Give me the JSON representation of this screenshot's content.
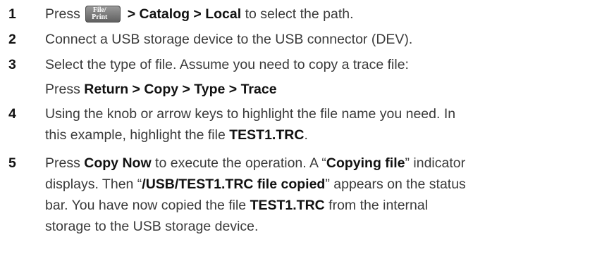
{
  "steps": [
    {
      "num": "1",
      "press": "Press",
      "key_line1": "File/",
      "key_line2": "Print",
      "path": "> Catalog > Local",
      "rest": "to select the path."
    },
    {
      "num": "2",
      "text": "Connect a USB storage device to the USB connector (DEV)."
    },
    {
      "num": "3",
      "text": "Select the type of file. Assume you need to copy a trace file:",
      "press": "Press",
      "path": "Return > Copy > Type > Trace"
    },
    {
      "num": "4",
      "line1": "Using the knob or arrow keys to highlight the file name you need. In",
      "line2a": "this example, highlight the file",
      "filename": "TEST1.TRC",
      "line2b": "."
    },
    {
      "num": "5",
      "l1a": "Press",
      "copy_now": "Copy Now",
      "l1b": "to execute the operation. A “",
      "copying": "Copying file",
      "l1c": "” indicator",
      "l2a": "displays. Then “",
      "copied_msg": "/USB/TEST1.TRC file copied",
      "l2b": "” appears on the status",
      "l3a": "bar. You have now copied the file",
      "filename": "TEST1.TRC",
      "l3b": "from the internal",
      "l4": "storage to the USB storage device."
    }
  ]
}
